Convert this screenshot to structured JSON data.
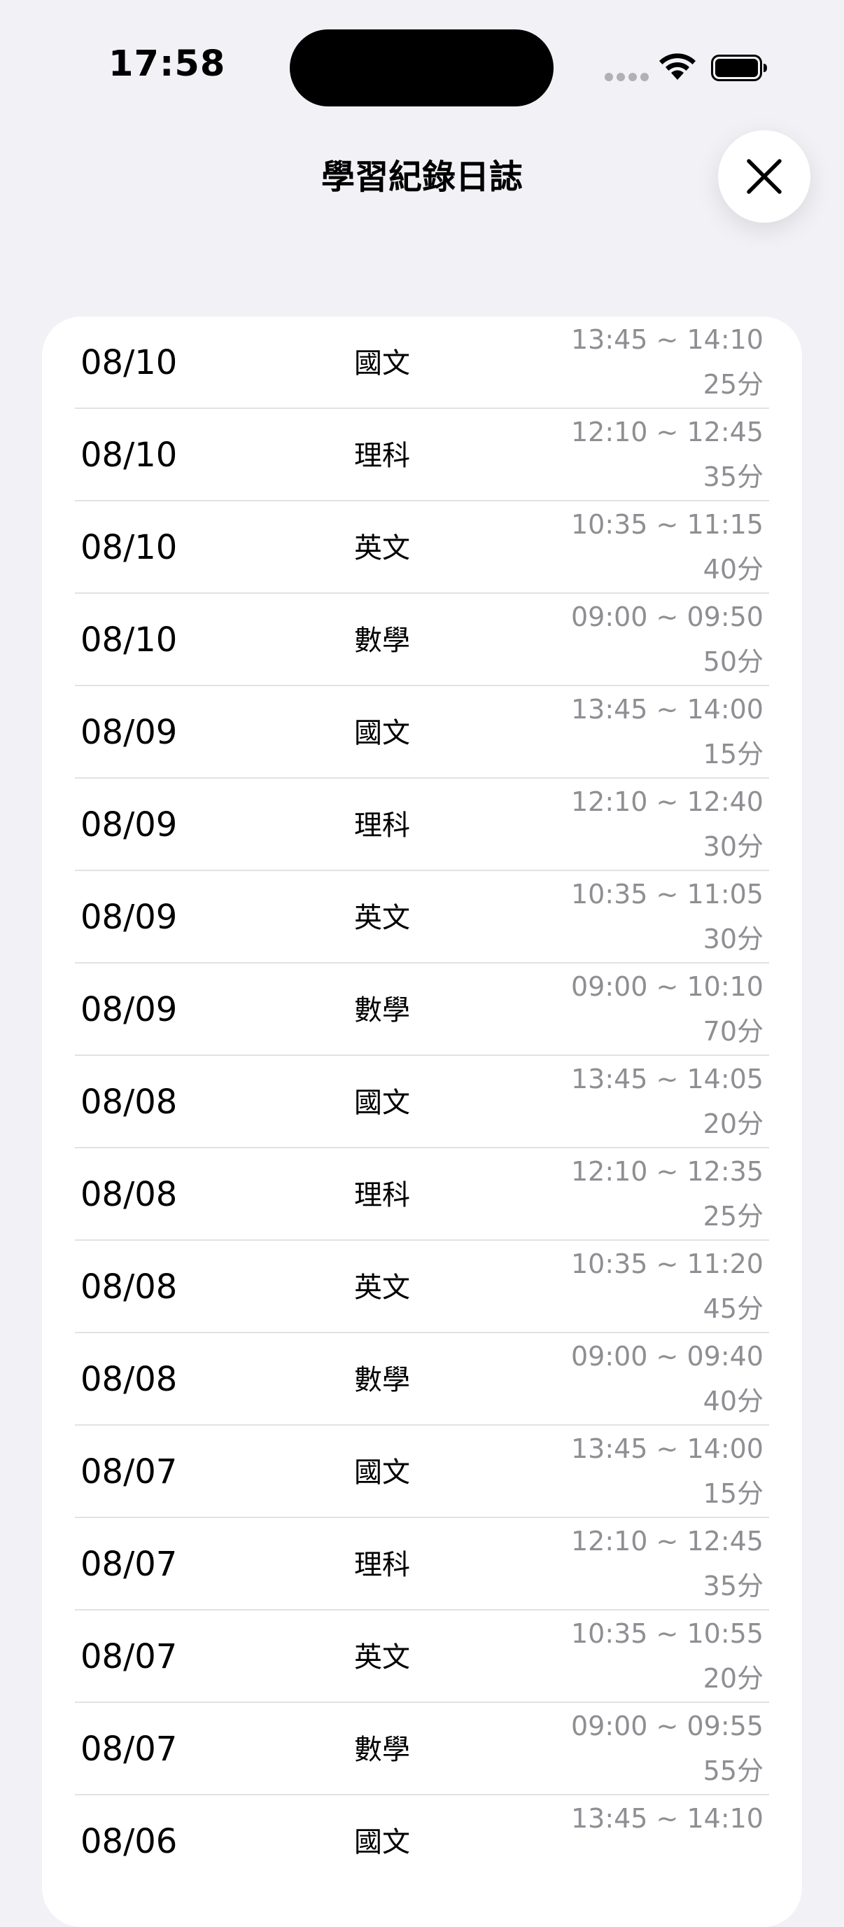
{
  "status_bar": {
    "time": "17:58"
  },
  "header": {
    "title": "學習紀錄日誌",
    "close_icon": "close-icon"
  },
  "colors": {
    "background": "#F1F1F6",
    "card": "#FFFFFF",
    "secondary_text": "#8E8E93",
    "divider": "#E2E2E6"
  },
  "records": [
    {
      "date": "08/10",
      "subject": "國文",
      "time_range": "13:45 ~ 14:10",
      "duration": "25分"
    },
    {
      "date": "08/10",
      "subject": "理科",
      "time_range": "12:10 ~ 12:45",
      "duration": "35分"
    },
    {
      "date": "08/10",
      "subject": "英文",
      "time_range": "10:35 ~ 11:15",
      "duration": "40分"
    },
    {
      "date": "08/10",
      "subject": "數學",
      "time_range": "09:00 ~ 09:50",
      "duration": "50分"
    },
    {
      "date": "08/09",
      "subject": "國文",
      "time_range": "13:45 ~ 14:00",
      "duration": "15分"
    },
    {
      "date": "08/09",
      "subject": "理科",
      "time_range": "12:10 ~ 12:40",
      "duration": "30分"
    },
    {
      "date": "08/09",
      "subject": "英文",
      "time_range": "10:35 ~ 11:05",
      "duration": "30分"
    },
    {
      "date": "08/09",
      "subject": "數學",
      "time_range": "09:00 ~ 10:10",
      "duration": "70分"
    },
    {
      "date": "08/08",
      "subject": "國文",
      "time_range": "13:45 ~ 14:05",
      "duration": "20分"
    },
    {
      "date": "08/08",
      "subject": "理科",
      "time_range": "12:10 ~ 12:35",
      "duration": "25分"
    },
    {
      "date": "08/08",
      "subject": "英文",
      "time_range": "10:35 ~ 11:20",
      "duration": "45分"
    },
    {
      "date": "08/08",
      "subject": "數學",
      "time_range": "09:00 ~ 09:40",
      "duration": "40分"
    },
    {
      "date": "08/07",
      "subject": "國文",
      "time_range": "13:45 ~ 14:00",
      "duration": "15分"
    },
    {
      "date": "08/07",
      "subject": "理科",
      "time_range": "12:10 ~ 12:45",
      "duration": "35分"
    },
    {
      "date": "08/07",
      "subject": "英文",
      "time_range": "10:35 ~ 10:55",
      "duration": "20分"
    },
    {
      "date": "08/07",
      "subject": "數學",
      "time_range": "09:00 ~ 09:55",
      "duration": "55分"
    },
    {
      "date": "08/06",
      "subject": "國文",
      "time_range": "13:45 ~ 14:10",
      "duration": ""
    }
  ]
}
